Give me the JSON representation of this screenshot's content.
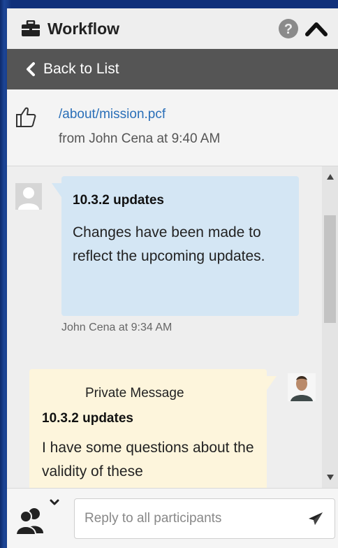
{
  "header": {
    "title": "Workflow",
    "title_icon": "briefcase-icon",
    "help_icon": "question-circle-icon",
    "collapse_icon": "chevron-up-icon"
  },
  "backbar": {
    "label": "Back to List",
    "icon": "chevron-left-icon"
  },
  "file": {
    "path": "/about/mission.pcf",
    "meta": "from John Cena at 9:40 AM",
    "icon": "thumbs-up-icon"
  },
  "messages": [
    {
      "title": "10.3.2 updates",
      "body": "Changes have been made to reflect the upcoming updates.",
      "meta": "John Cena at 9:34 AM",
      "avatar": "generic-user-avatar",
      "color": "#d4e6f4"
    },
    {
      "label": "Private Message",
      "title": "10.3.2 updates",
      "body": "I have some questions about the validity of these",
      "avatar": "user-photo-avatar",
      "color": "#fdf5dc"
    }
  ],
  "reply": {
    "placeholder": "Reply to all participants",
    "participants_icon": "users-icon",
    "send_icon": "paper-plane-icon"
  },
  "colors": {
    "backbar_bg": "#555555",
    "link": "#2a6fb8",
    "frame": "#1a3a7a"
  }
}
